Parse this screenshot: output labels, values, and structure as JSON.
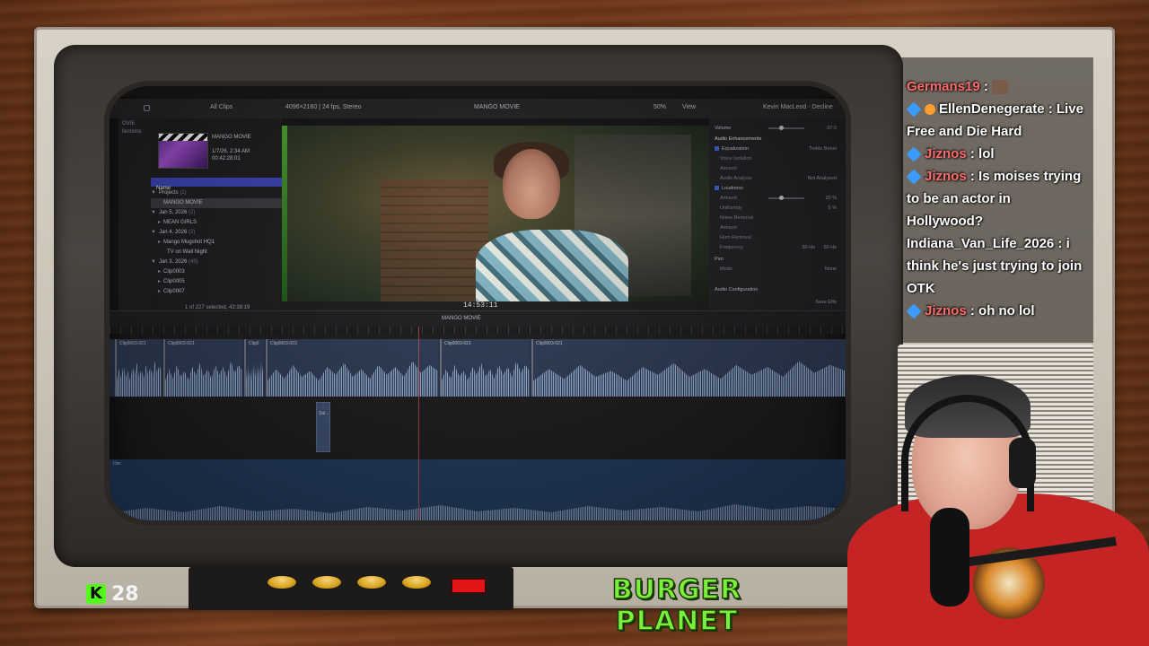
{
  "tv": {
    "kick_count": "28",
    "brand_title": "BURGER PLANET",
    "knob_labels": [
      "",
      "",
      "",
      ""
    ]
  },
  "fcp": {
    "toolbar": {
      "filter": "All Clips",
      "format": "4096×2160 | 24 fps, Stereo",
      "project_title": "MANGO MOVIE",
      "zoom": "50%",
      "view": "View",
      "inspector_title": "Kevin MacLeod - Decline"
    },
    "sidebar": {
      "items": [
        "OVIE",
        "llections"
      ]
    },
    "browser": {
      "clip_name": "MANGO MOVIE",
      "clip_date": "1/7/26, 2:34 AM",
      "clip_duration": "00:42:28:01",
      "column_name": "Name",
      "rows": [
        {
          "label": "Projects",
          "count": "(1)"
        },
        {
          "label": "MANGO MOVIE",
          "count": ""
        },
        {
          "label": "Jan 5, 2026",
          "count": "(2)"
        },
        {
          "label": "MEAN GIRLS",
          "count": ""
        },
        {
          "label": "Jan 4, 2026",
          "count": "(2)"
        },
        {
          "label": "Mango Mugshot HQ1",
          "count": ""
        },
        {
          "label": "TV on Wall Night",
          "count": ""
        },
        {
          "label": "Jan 3, 2026",
          "count": "(45)"
        },
        {
          "label": "Clip0003",
          "count": ""
        },
        {
          "label": "Clip0005",
          "count": ""
        },
        {
          "label": "Clip0007",
          "count": ""
        }
      ],
      "footer": "1 of 227 selected, 43:38:19"
    },
    "viewer": {
      "timecode": "14:53:11"
    },
    "inspector": {
      "volume_label": "Volume",
      "volume_value": "-37.0",
      "section": "Audio Enhancements",
      "eq_label": "Equalization",
      "eq_value": "Treble Boost",
      "voice_isolation": "Voice Isolation",
      "amount": "Amount",
      "audio_analysis": "Audio Analysis",
      "audio_analysis_value": "Not Analyzed",
      "loudness": "Loudness",
      "loudness_amount": "20 %",
      "uniformity": "Uniformity",
      "uniformity_value": "5 %",
      "noise_removal": "Noise Removal",
      "hum_removal": "Hum Removal",
      "frequency": "Frequency",
      "frequency_value": "50 Hz",
      "frequency_value_alt": "60 Hz",
      "pan": "Pan",
      "mode": "Mode",
      "mode_value": "None",
      "audio_config": "Audio Configuration",
      "save_effects": "Save Effe"
    },
    "timeline": {
      "project_name": "MANGO MOVIE",
      "clip_labels": [
        "Clip0003-021",
        "Clip0003-021",
        "Clip0",
        "Clip0003-023",
        "Clip0003-021",
        "Clip0003-021"
      ],
      "small_clip_label": "Sal...",
      "music_label": "Unc"
    }
  },
  "chat": {
    "messages": [
      {
        "user": "Germans19",
        "text": ""
      },
      {
        "user": "EllenDenegerate",
        "text": "Live Free and Die Hard"
      },
      {
        "user": "Jiznos",
        "text": "lol"
      },
      {
        "user": "Jiznos",
        "text": "Is moises trying to be an actor in Hollywood?"
      },
      {
        "user": "Indiana_Van_Life_2026",
        "text": "i think he's just trying to join OTK"
      },
      {
        "user": "Jiznos",
        "text": "oh no lol"
      }
    ]
  }
}
